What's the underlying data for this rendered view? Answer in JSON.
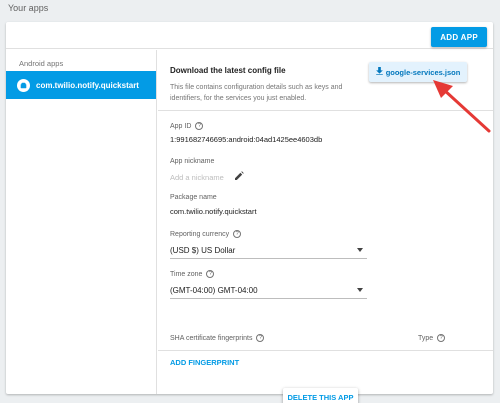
{
  "section_title": "Your apps",
  "header": {
    "add_app_label": "ADD APP"
  },
  "sidebar": {
    "heading": "Android apps",
    "items": [
      {
        "label": "com.twilio.notify.quickstart",
        "icon": "android-app-icon"
      }
    ]
  },
  "download": {
    "title": "Download the latest config file",
    "description": "This file contains configuration details such as keys and identifiers, for the services you just enabled.",
    "button_label": "google-services.json",
    "button_icon": "download-icon"
  },
  "app_id": {
    "label": "App ID",
    "value": "1:991682746695:android:04ad1425ee4603db"
  },
  "app_nickname": {
    "label": "App nickname",
    "placeholder": "Add a nickname"
  },
  "package_name": {
    "label": "Package name",
    "value": "com.twilio.notify.quickstart"
  },
  "reporting_currency": {
    "label": "Reporting currency",
    "selected": "(USD $) US Dollar"
  },
  "time_zone": {
    "label": "Time zone",
    "selected": "(GMT-04:00) GMT-04:00"
  },
  "sha": {
    "label": "SHA certificate fingerprints",
    "type_label": "Type",
    "add_label": "ADD FINGERPRINT"
  },
  "delete_label": "DELETE THIS APP",
  "help_glyph": "?",
  "colors": {
    "accent": "#039be5",
    "annotation_arrow": "#e53935"
  }
}
